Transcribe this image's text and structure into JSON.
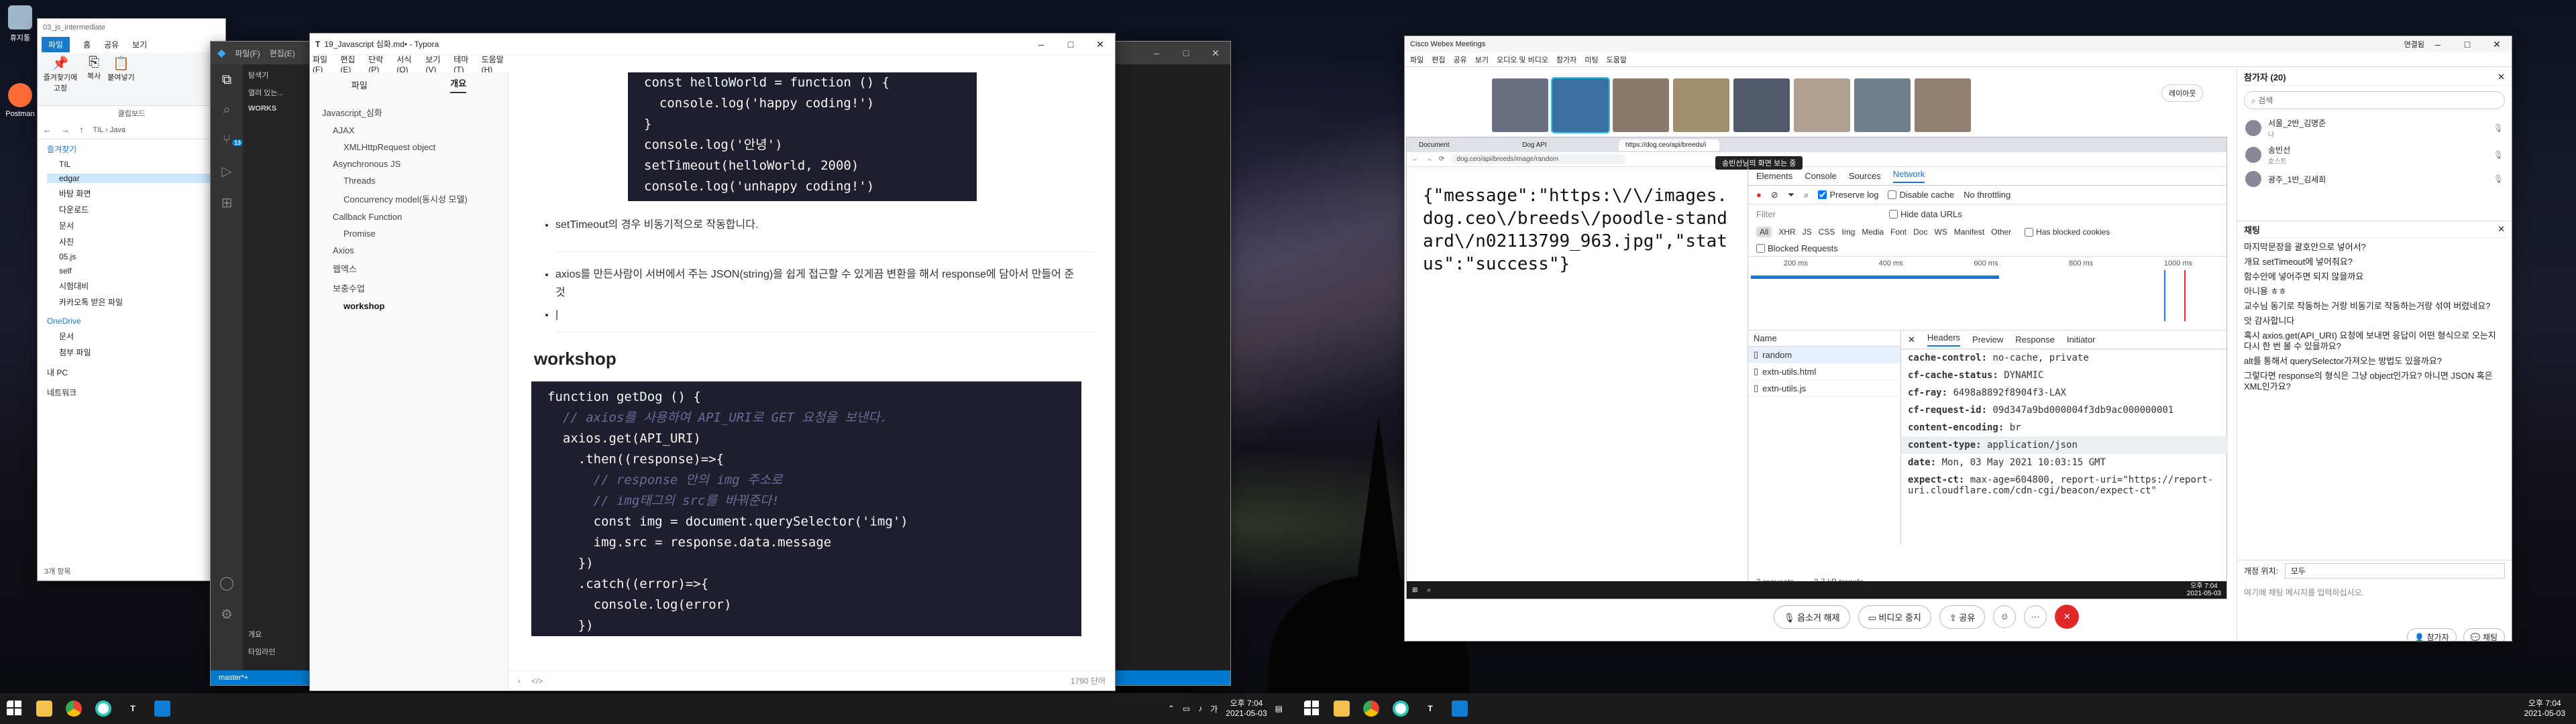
{
  "desktop": {
    "icons": [
      {
        "label": "휴지통"
      },
      {
        "label": "Postman"
      }
    ]
  },
  "explorer": {
    "tabs": [
      "파일",
      "홈",
      "공유",
      "보기"
    ],
    "ribbon": [
      "즐겨찾기에 고정",
      "복사",
      "붙여넣기"
    ],
    "clipboard": "클립보드",
    "address": "TIL › Java",
    "path_title": "03_js_intermediate",
    "side": [
      "즐겨찾기",
      "TIL",
      "edgar",
      "바탕 화면",
      "다운로드",
      "문서",
      "사진",
      "05.js",
      "self",
      "시험대비",
      "카카오톡 받은 파일",
      "OneDrive",
      "문서",
      "첨부 파일",
      "내 PC",
      "네트워크"
    ],
    "status": "3개 항목"
  },
  "vscode": {
    "explorer_title": "탐색기",
    "open_editors": "열려 있는...",
    "workspace": "WORKS",
    "outline": "개요",
    "timeline": "타임라인",
    "branch": "master*+",
    "badge": "13",
    "menu": [
      "파일(F)",
      "편집(E)"
    ]
  },
  "typora": {
    "title": "19_Javascript 심화.md• - Typora",
    "menu": [
      "파일(F)",
      "편집(E)",
      "단락(P)",
      "서식(O)",
      "보기(V)",
      "테마(T)",
      "도움말(H)"
    ],
    "side_tabs": [
      "파일",
      "개요"
    ],
    "outline": [
      {
        "t": "Javascript_심화",
        "lv": 0
      },
      {
        "t": "AJAX",
        "lv": 1
      },
      {
        "t": "XMLHttpRequest object",
        "lv": 2
      },
      {
        "t": "Asynchronous JS",
        "lv": 1
      },
      {
        "t": "Threads",
        "lv": 2
      },
      {
        "t": "Concurrency model(동시성 모델)",
        "lv": 2
      },
      {
        "t": "Callback Function",
        "lv": 1
      },
      {
        "t": "Promise",
        "lv": 2
      },
      {
        "t": "Axios",
        "lv": 1
      },
      {
        "t": "웹엑스",
        "lv": 1
      },
      {
        "t": "보충수업",
        "lv": 1
      },
      {
        "t": "workshop",
        "lv": 2
      }
    ],
    "code1": [
      "const helloWorld = function () {",
      "  console.log('happy coding!')",
      "}",
      "console.log('안녕')",
      "setTimeout(helloWorld, 2000)",
      "console.log('unhappy coding!')"
    ],
    "bullet1": "setTimeout의 경우 비동기적으로 작동합니다.",
    "bullet2": "axios를 만든사람이 서버에서 주는 JSON(string)을 쉽게 접근할 수 있게끔 변환을 해서 response에 담아서 만들어 준 것",
    "heading": "workshop",
    "code2": [
      "function getDog () {",
      "  // axios를 사용하여 API_URI로 GET 요청을 보낸다.",
      "  axios.get(API_URI)",
      "    .then((response)=>{",
      "      // response 안의 img 주소로",
      "      // img태그의 src를 바꿔준다!",
      "      const img = document.querySelector('img')",
      "      img.src = response.data.message",
      "    })",
      "    .catch((error)=>{",
      "      console.log(error)",
      "    })"
    ],
    "wordcount": "1790 단어"
  },
  "webex": {
    "title": "Cisco Webex Meetings",
    "menu": [
      "파일",
      "편집",
      "공유",
      "보기",
      "오디오 및 비디오",
      "참가자",
      "미팅",
      "도움말"
    ],
    "connected": "연결됨",
    "share_banner": "송빈선님의 화면 보는 중",
    "layout": "레이아웃",
    "remote": {
      "tabs": [
        "Document",
        "Dog API",
        "https://dog.ceo/api/breeds/i"
      ],
      "url": "dog.ceo/api/breeds/image/random",
      "json": "{\"message\":\"https:\\/\\/images.dog.ceo\\/breeds\\/poodle-standard\\/n02113799_963.jpg\",\"status\":\"success\"}",
      "devtools_tabs": [
        "Elements",
        "Console",
        "Sources",
        "Network"
      ],
      "preserve": "Preserve log",
      "disable_cache": "Disable cache",
      "throttle": "No throttling",
      "filter": "Filter",
      "hide_data": "Hide data URLs",
      "types": [
        "All",
        "XHR",
        "JS",
        "CSS",
        "Img",
        "Media",
        "Font",
        "Doc",
        "WS",
        "Manifest",
        "Other"
      ],
      "blocked": "Has blocked cookies",
      "blocked_req": "Blocked Requests",
      "ticks": [
        "200 ms",
        "400 ms",
        "600 ms",
        "800 ms",
        "1000 ms"
      ],
      "name_col": "Name",
      "files": [
        "random",
        "extn-utils.html",
        "extn-utils.js"
      ],
      "detail_tabs": [
        "Headers",
        "Preview",
        "Response",
        "Initiator"
      ],
      "headers": [
        [
          "cache-control:",
          "no-cache, private"
        ],
        [
          "cf-cache-status:",
          "DYNAMIC"
        ],
        [
          "cf-ray:",
          "6498a8892f8904f3-LAX"
        ],
        [
          "cf-request-id:",
          "09d347a9bd000004f3db9ac000000001"
        ],
        [
          "content-encoding:",
          "br"
        ],
        [
          "content-type:",
          "application/json"
        ],
        [
          "date:",
          "Mon, 03 May 2021 10:03:15 GMT"
        ],
        [
          "expect-ct:",
          "max-age=604800, report-uri=\"https://report-uri.cloudflare.com/cdn-cgi/beacon/expect-ct\""
        ]
      ],
      "status": [
        "3 requests",
        "2.7 kB transfe"
      ],
      "clock": "오후 7:04",
      "date": "2021-05-03"
    },
    "controls": [
      "음소거 해제",
      "비디오 중지",
      "공유"
    ],
    "participants": {
      "title": "참가자 (20)",
      "search": "검색",
      "list": [
        {
          "name": "서울_2반_김명준",
          "role": "나"
        },
        {
          "name": "송빈선",
          "role": "호스트"
        },
        {
          "name": "광주_1반_김세희",
          "role": ""
        }
      ]
    },
    "chat": {
      "title": "채팅",
      "messages": [
        "마지막문장을 괄호안으로 넣어서?",
        "개요 setTimeout에 넣어줘요?",
        "함수안에 넣어주면 되지 않을까요",
        "아니용 ㅎㅎ",
        "교수님 동기로 작동하는 거랑 비동기로 작동하는거랑 섞여 버렸네요?",
        "앗 감사합니다",
        "혹시 axios.get(API_URI) 요청에 보내면 응답이 어떤 형식으로 오는지 다시 한 번 볼 수 있을까요?",
        "alt를 통해서 querySelector가져오는 방법도 있을까요?",
        "그렇다면 response의 형식은 그냥 object인가요? 아니면 JSON 혹은 XML인가요?"
      ],
      "to_label": "개정 위치:",
      "to_value": "모두",
      "placeholder": "여기에 채팅 메시지를 입력하십시오.",
      "participants_btn": "참가자",
      "chat_btn": "채팅"
    }
  },
  "taskbar1": {
    "clock": "오후 7:04",
    "date": "2021-05-03",
    "lang": "가"
  },
  "taskbar2": {
    "clock": "오후 7:04",
    "date": "2021-05-03"
  }
}
